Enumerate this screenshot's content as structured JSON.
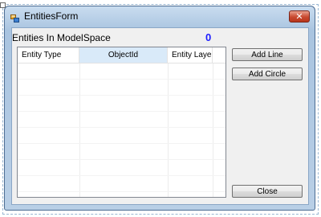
{
  "window": {
    "title": "EntitiesForm",
    "close_glyph": "✕"
  },
  "header": {
    "entities_label": "Entities In ModelSpace",
    "entities_count": "0"
  },
  "grid": {
    "columns": [
      {
        "label": "Entity Type"
      },
      {
        "label": "ObjectId"
      },
      {
        "label": "Entity Layer"
      }
    ],
    "rows": []
  },
  "buttons": {
    "add_line": "Add Line",
    "add_circle": "Add Circle",
    "close": "Close"
  },
  "colors": {
    "count_color": "#1c1cff",
    "selected_column_bg": "#d9eaf9",
    "close_button_red": "#c8492f"
  },
  "icons": {
    "app_icon": "form-icon",
    "close_icon": "close-icon"
  }
}
